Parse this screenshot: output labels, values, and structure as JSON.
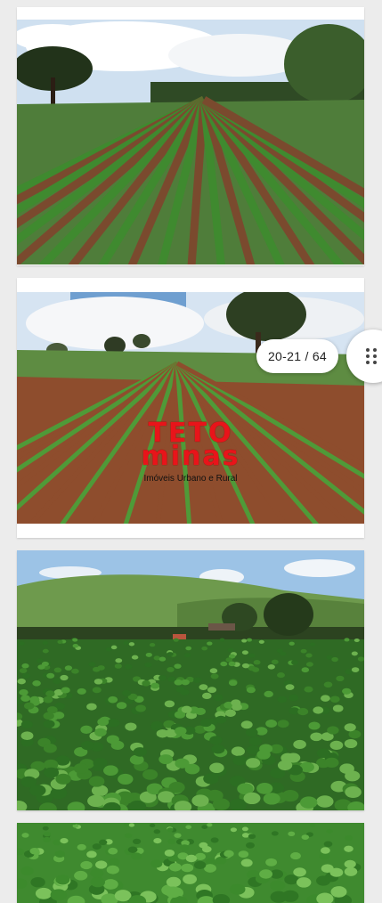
{
  "gallery": {
    "counter": "20-21 / 64",
    "grid_button": {
      "icon": "grid-dots-icon"
    }
  },
  "watermark": {
    "brand_line1": "TETO",
    "brand_line2": "minas",
    "tagline": "Imóveis Urbano e Rural"
  },
  "photos": [
    {
      "subject": "young-crop-rows-field"
    },
    {
      "subject": "crop-rows-field-with-trees"
    },
    {
      "subject": "soybean-field-hills-farmhouse"
    },
    {
      "subject": "soybean-leaves-closeup"
    }
  ],
  "colors": {
    "background": "#ececec",
    "card": "#ffffff",
    "watermark_red": "#e8141a",
    "soil": "#8a4a2c",
    "crop_green": "#3f8a2f"
  }
}
